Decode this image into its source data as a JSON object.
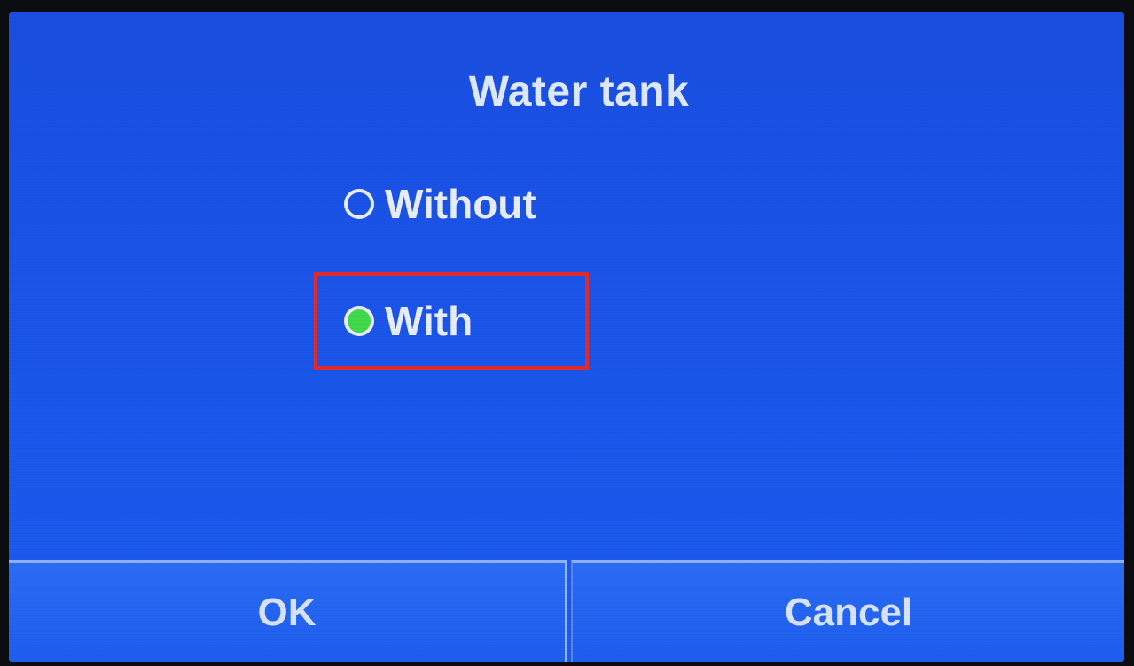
{
  "dialog": {
    "title": "Water tank",
    "options": [
      {
        "label": "Without",
        "selected": false
      },
      {
        "label": "With",
        "selected": true
      }
    ],
    "buttons": {
      "ok_label": "OK",
      "cancel_label": "Cancel"
    }
  },
  "colors": {
    "background": "#1b55ea",
    "selected_radio": "#3fd94a",
    "highlight": "#e22a2a",
    "text": "#e8eeff"
  }
}
